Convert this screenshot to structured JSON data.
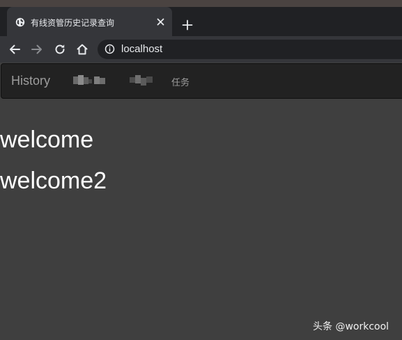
{
  "browser": {
    "tab_title": "有线资管历史记录查询",
    "url": "localhost",
    "icons": {
      "favicon": "globe-icon",
      "close": "close-icon",
      "new_tab": "plus-icon",
      "back": "arrow-left-icon",
      "forward": "arrow-right-icon",
      "reload": "reload-icon",
      "home": "home-icon",
      "site_info": "info-icon"
    }
  },
  "navbar": {
    "brand": "History",
    "task_label": "任务"
  },
  "content": {
    "heading1": "welcome",
    "heading2": "welcome2"
  },
  "watermark": "头条 @workcool"
}
